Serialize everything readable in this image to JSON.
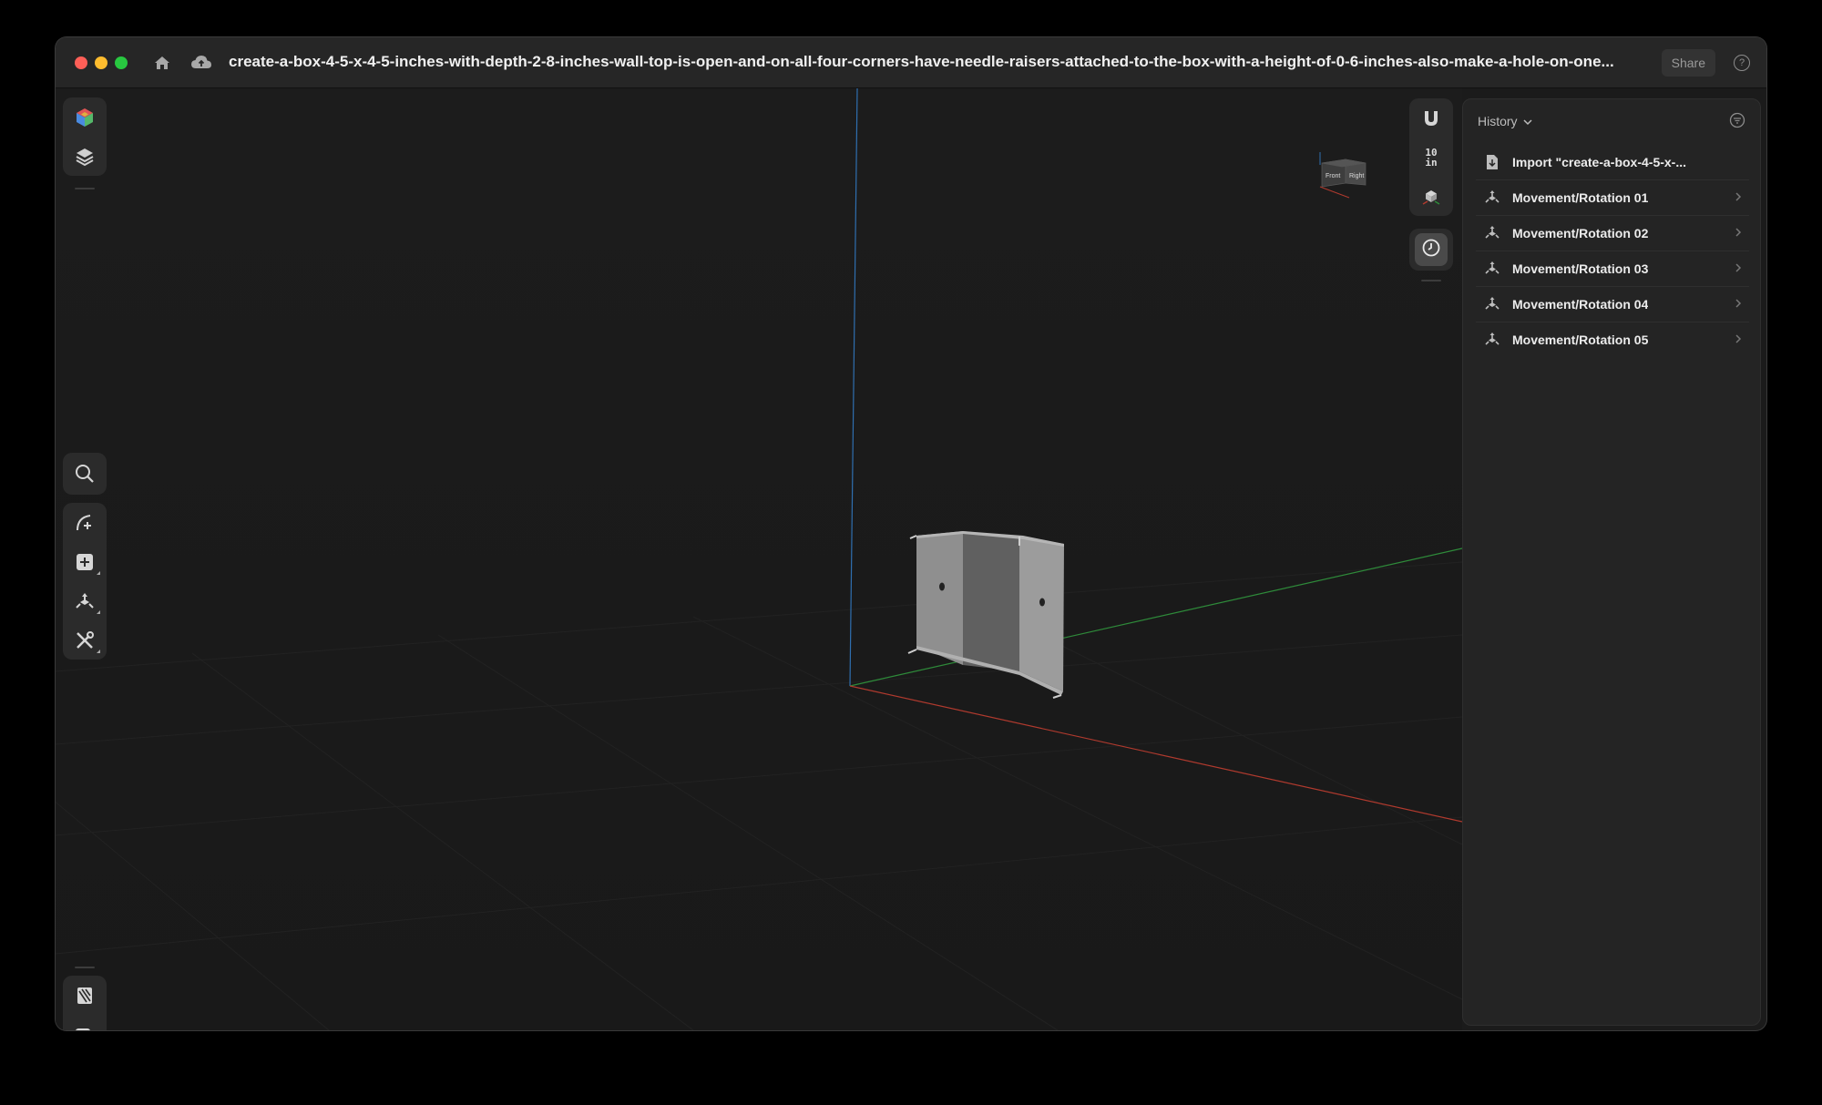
{
  "window": {
    "title": "create-a-box-4-5-x-4-5-inches-with-depth-2-8-inches-wall-top-is-open-and-on-all-four-corners-have-needle-raisers-attached-to-the-box-with-a-height-of-0-6-inches-also-make-a-hole-on-one...",
    "share_label": "Share",
    "help_label": "?"
  },
  "viewport": {
    "units_value": "10",
    "units_label": "in",
    "viewcube": {
      "front_label": "Front",
      "right_label": "Right"
    },
    "axis_colors": {
      "x": "#b03a2e",
      "y": "#2e8b3a",
      "z": "#2f6fb0"
    }
  },
  "left_toolbar": {
    "top_tools": [
      "color-cube-icon",
      "layers-icon"
    ],
    "search_tool": "search-icon",
    "mid_tools": [
      "sketch-icon",
      "add-shape-icon",
      "transform-icon",
      "tools-icon"
    ],
    "bottom_tools": [
      "texture-icon",
      "print-icon"
    ]
  },
  "right_toolbar": {
    "tools": [
      "magnet-icon",
      "units-toggle",
      "view-cube-icon"
    ],
    "history_toggle": "clock-icon"
  },
  "history": {
    "title": "History",
    "items": [
      {
        "label": "Import \"create-a-box-4-5-x-...",
        "icon": "file-import-icon",
        "has_chevron": false
      },
      {
        "label": "Movement/Rotation 01",
        "icon": "transform-icon",
        "has_chevron": true
      },
      {
        "label": "Movement/Rotation 02",
        "icon": "transform-icon",
        "has_chevron": true
      },
      {
        "label": "Movement/Rotation 03",
        "icon": "transform-icon",
        "has_chevron": true
      },
      {
        "label": "Movement/Rotation 04",
        "icon": "transform-icon",
        "has_chevron": true
      },
      {
        "label": "Movement/Rotation 05",
        "icon": "transform-icon",
        "has_chevron": true
      }
    ]
  }
}
